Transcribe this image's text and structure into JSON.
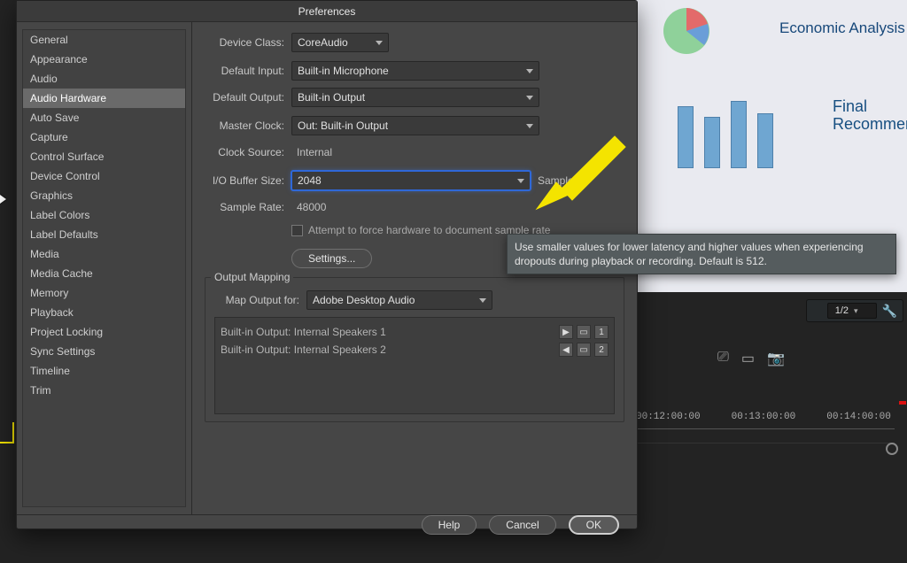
{
  "dialog": {
    "title": "Preferences",
    "buttons": {
      "help": "Help",
      "cancel": "Cancel",
      "ok": "OK",
      "settings": "Settings..."
    }
  },
  "sidebar": {
    "items": [
      "General",
      "Appearance",
      "Audio",
      "Audio Hardware",
      "Auto Save",
      "Capture",
      "Control Surface",
      "Device Control",
      "Graphics",
      "Label Colors",
      "Label Defaults",
      "Media",
      "Media Cache",
      "Memory",
      "Playback",
      "Project Locking",
      "Sync Settings",
      "Timeline",
      "Trim"
    ],
    "selected_index": 3
  },
  "pane": {
    "device_class": {
      "label": "Device Class:",
      "value": "CoreAudio"
    },
    "default_input": {
      "label": "Default Input:",
      "value": "Built-in Microphone"
    },
    "default_output": {
      "label": "Default Output:",
      "value": "Built-in Output"
    },
    "master_clock": {
      "label": "Master Clock:",
      "value": "Out: Built-in Output"
    },
    "clock_source": {
      "label": "Clock Source:",
      "value": "Internal"
    },
    "io_buffer": {
      "label": "I/O Buffer Size:",
      "value": "2048",
      "unit": "Samples"
    },
    "sample_rate": {
      "label": "Sample Rate:",
      "value": "48000"
    },
    "force_checkbox": "Attempt to force hardware to document sample rate",
    "output_mapping": {
      "legend": "Output Mapping",
      "map_label": "Map Output for:",
      "map_value": "Adobe Desktop Audio",
      "rows": [
        {
          "text": "Built-in Output: Internal Speakers 1",
          "num": "1"
        },
        {
          "text": "Built-in Output: Internal Speakers 2",
          "num": "2"
        }
      ]
    }
  },
  "tooltip": "Use smaller values for lower latency and higher values when experiencing dropouts during playback or recording. Default is 512.",
  "background": {
    "slide": {
      "title": "Economic Analysis",
      "sub1": "Final",
      "sub2": "Recommend"
    },
    "zoom": "1/2",
    "timecodes": [
      "00:12:00:00",
      "00:13:00:00",
      "00:14:00:00"
    ]
  }
}
